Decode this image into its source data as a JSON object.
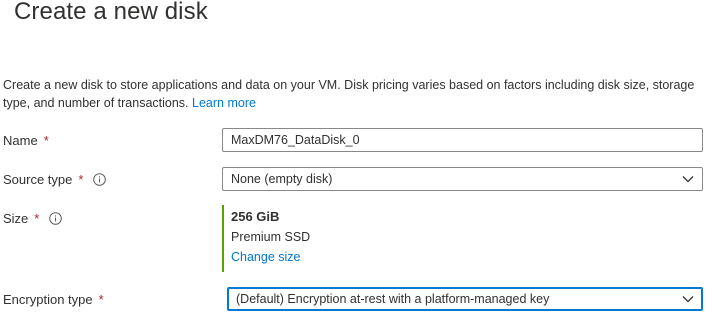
{
  "title": "Create a new disk",
  "description": {
    "text": "Create a new disk to store applications and data on your VM. Disk pricing varies based on factors including disk size, storage type, and number of transactions.",
    "learn_more": "Learn more"
  },
  "fields": {
    "name": {
      "label": "Name",
      "required_mark": "*",
      "value": "MaxDM76_DataDisk_0"
    },
    "source_type": {
      "label": "Source type",
      "required_mark": "*",
      "value": "None (empty disk)",
      "icon": "info-icon"
    },
    "size": {
      "label": "Size",
      "required_mark": "*",
      "icon": "info-icon",
      "value": "256 GiB",
      "tier": "Premium SSD",
      "change_link": "Change size"
    },
    "encryption_type": {
      "label": "Encryption type",
      "required_mark": "*",
      "value": "(Default) Encryption at-rest with a platform-managed key"
    }
  },
  "colors": {
    "link": "#0078d4",
    "required": "#a4262c",
    "size_accent": "#57a300",
    "focus_border": "#0078d4"
  }
}
